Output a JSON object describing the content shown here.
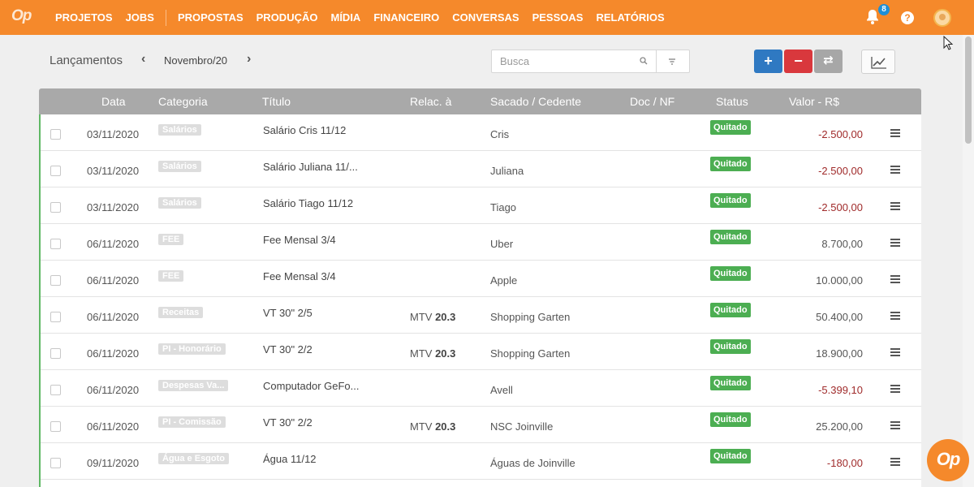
{
  "app": {
    "logo": "Op",
    "nav": [
      "PROJETOS",
      "JOBS",
      "PROPOSTAS",
      "PRODUÇÃO",
      "MÍDIA",
      "FINANCEIRO",
      "CONVERSAS",
      "PESSOAS",
      "RELATÓRIOS"
    ],
    "notifications_count": "8",
    "help_label": "?",
    "brand_color": "#f5892b"
  },
  "toolbar": {
    "title": "Lançamentos",
    "prev": "‹",
    "month": "Novembro/20",
    "next": "›",
    "search_placeholder": "Busca",
    "add_label": "+",
    "subtract_label": "−",
    "transfer_label": "⇄"
  },
  "table": {
    "headers": {
      "date": "Data",
      "category": "Categoria",
      "title": "Título",
      "related": "Relac. à",
      "party": "Sacado / Cedente",
      "doc": "Doc / NF",
      "status": "Status",
      "value": "Valor - R$"
    },
    "rows": [
      {
        "date": "03/11/2020",
        "category": "Salários",
        "title": "Salário Cris 11/12",
        "rel_prefix": "",
        "rel_num": "",
        "party": "Cris",
        "status": "Quitado",
        "value": "-2.500,00"
      },
      {
        "date": "03/11/2020",
        "category": "Salários",
        "title": "Salário Juliana 11/...",
        "rel_prefix": "",
        "rel_num": "",
        "party": "Juliana",
        "status": "Quitado",
        "value": "-2.500,00"
      },
      {
        "date": "03/11/2020",
        "category": "Salários",
        "title": "Salário Tiago 11/12",
        "rel_prefix": "",
        "rel_num": "",
        "party": "Tiago",
        "status": "Quitado",
        "value": "-2.500,00"
      },
      {
        "date": "06/11/2020",
        "category": "FEE",
        "title": "Fee Mensal 3/4",
        "rel_prefix": "",
        "rel_num": "",
        "party": "Uber",
        "status": "Quitado",
        "value": "8.700,00"
      },
      {
        "date": "06/11/2020",
        "category": "FEE",
        "title": "Fee Mensal 3/4",
        "rel_prefix": "",
        "rel_num": "",
        "party": "Apple",
        "status": "Quitado",
        "value": "10.000,00"
      },
      {
        "date": "06/11/2020",
        "category": "Receitas",
        "title": "VT 30\" 2/5",
        "rel_prefix": "MTV ",
        "rel_num": "20.3",
        "party": "Shopping Garten",
        "status": "Quitado",
        "value": "50.400,00"
      },
      {
        "date": "06/11/2020",
        "category": "PI - Honorário",
        "title": "VT 30\" 2/2",
        "rel_prefix": "MTV ",
        "rel_num": "20.3",
        "party": "Shopping Garten",
        "status": "Quitado",
        "value": "18.900,00"
      },
      {
        "date": "06/11/2020",
        "category": "Despesas Va...",
        "title": "Computador GeFo...",
        "rel_prefix": "",
        "rel_num": "",
        "party": "Avell",
        "status": "Quitado",
        "value": "-5.399,10"
      },
      {
        "date": "06/11/2020",
        "category": "PI - Comissão",
        "title": "VT 30\" 2/2",
        "rel_prefix": "MTV ",
        "rel_num": "20.3",
        "party": "NSC Joinville",
        "status": "Quitado",
        "value": "25.200,00"
      },
      {
        "date": "09/11/2020",
        "category": "Água e Esgoto",
        "title": "Água 11/12",
        "rel_prefix": "",
        "rel_num": "",
        "party": "Águas de Joinville",
        "status": "Quitado",
        "value": "-180,00"
      }
    ]
  },
  "chat_fab": "Op"
}
